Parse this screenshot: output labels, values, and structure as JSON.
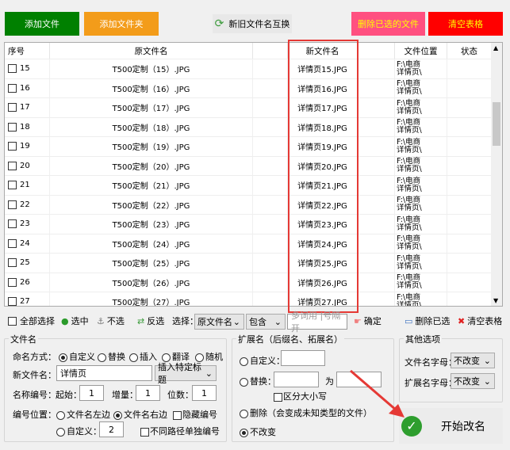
{
  "toolbar": {
    "add_file": "添加文件",
    "add_folder": "添加文件夹",
    "swap": "新旧文件名互换",
    "delete_selected": "删除已选的文件",
    "clear_table": "清空表格"
  },
  "colors": {
    "add_file": "#008000",
    "add_folder": "#f39c1a",
    "delete_selected": "#ff5080",
    "clear_table": "#ff0000",
    "highlight": "#e53935"
  },
  "table": {
    "headers": [
      "序号",
      "原文件名",
      "",
      "新文件名",
      "",
      "文件位置",
      "状态"
    ],
    "rows": [
      {
        "no": "15",
        "orig": "T500定制（15）.JPG",
        "new": "详情页15.JPG",
        "loc": "F:\\电商\n详情页\\"
      },
      {
        "no": "16",
        "orig": "T500定制（16）.JPG",
        "new": "详情页16.JPG",
        "loc": "F:\\电商\n详情页\\"
      },
      {
        "no": "17",
        "orig": "T500定制（17）.JPG",
        "new": "详情页17.JPG",
        "loc": "F:\\电商\n详情页\\"
      },
      {
        "no": "18",
        "orig": "T500定制（18）.JPG",
        "new": "详情页18.JPG",
        "loc": "F:\\电商\n详情页\\"
      },
      {
        "no": "19",
        "orig": "T500定制（19）.JPG",
        "new": "详情页19.JPG",
        "loc": "F:\\电商\n详情页\\"
      },
      {
        "no": "20",
        "orig": "T500定制（20）.JPG",
        "new": "详情页20.JPG",
        "loc": "F:\\电商\n详情页\\"
      },
      {
        "no": "21",
        "orig": "T500定制（21）.JPG",
        "new": "详情页21.JPG",
        "loc": "F:\\电商\n详情页\\"
      },
      {
        "no": "22",
        "orig": "T500定制（22）.JPG",
        "new": "详情页22.JPG",
        "loc": "F:\\电商\n详情页\\"
      },
      {
        "no": "23",
        "orig": "T500定制（23）.JPG",
        "new": "详情页23.JPG",
        "loc": "F:\\电商\n详情页\\"
      },
      {
        "no": "24",
        "orig": "T500定制（24）.JPG",
        "new": "详情页24.JPG",
        "loc": "F:\\电商\n详情页\\"
      },
      {
        "no": "25",
        "orig": "T500定制（25）.JPG",
        "new": "详情页25.JPG",
        "loc": "F:\\电商\n详情页\\"
      },
      {
        "no": "26",
        "orig": "T500定制（26）.JPG",
        "new": "详情页26.JPG",
        "loc": "F:\\电商\n详情页\\"
      },
      {
        "no": "27",
        "orig": "T500定制（27）.JPG",
        "new": "详情页27.JPG",
        "loc": "F:\\电商\n详情页\\"
      }
    ]
  },
  "selbar": {
    "select_all": "全部选择",
    "select": "选中",
    "deselect": "不选",
    "invert": "反选",
    "choose_label": "选择：",
    "field": "原文件名",
    "match": "包含",
    "keyword_placeholder": "多词用 |号隔开",
    "confirm": "确定",
    "delete_selected": "删除已选",
    "clear_table": "清空表格"
  },
  "filename": {
    "legend": "文件名",
    "mode_label": "命名方式：",
    "modes": [
      "自定义",
      "替换",
      "插入",
      "翻译",
      "随机"
    ],
    "new_name_label": "新文件名：",
    "new_name": "详情页",
    "insert_title": "插入特定标题",
    "number_label": "名称编号：",
    "start_label": "起始：",
    "start": "1",
    "step_label": "增量：",
    "step": "1",
    "digits_label": "位数：",
    "digits": "1",
    "pos_label": "编号位置：",
    "pos_left": "文件名左边",
    "pos_right": "文件名右边",
    "hide_number": "隐藏编号",
    "pos_custom": "自定义：",
    "pos_custom_value": "2",
    "separate_path": "不同路径单独编号"
  },
  "extension": {
    "legend": "扩展名（后缀名、拓展名）",
    "custom": "自定义：",
    "replace": "替换：",
    "to": "为",
    "case_sensitive": "区分大小写",
    "delete": "删除（会变成未知类型的文件）",
    "unchanged": "不改变"
  },
  "other": {
    "legend": "其他选项",
    "filename_case_label": "文件名字母：",
    "filename_case": "不改变",
    "ext_case_label": "扩展名字母：",
    "ext_case": "不改变"
  },
  "start_button": "开始改名"
}
